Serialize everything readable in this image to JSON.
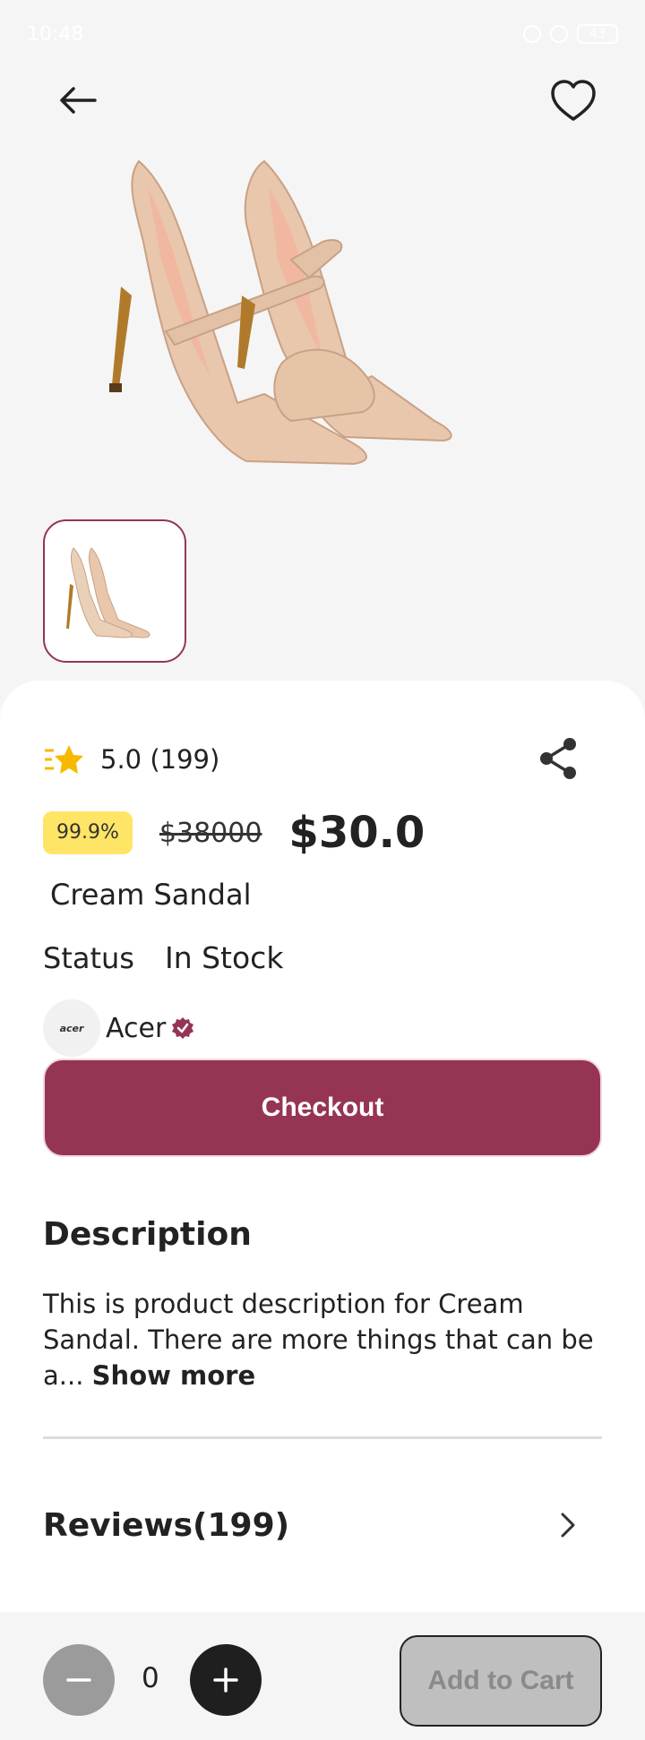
{
  "status_bar": {
    "time": "10:48",
    "battery": "43"
  },
  "product": {
    "rating": "5.0 (199)",
    "discount": "99.9%",
    "old_price": "$38000",
    "price": "$30.0",
    "name": "Cream Sandal",
    "status_label": "Status",
    "status_value": "In Stock"
  },
  "brand": {
    "logo_text": "acer",
    "name": "Acer"
  },
  "actions": {
    "checkout_label": "Checkout",
    "add_to_cart_label": "Add to Cart"
  },
  "description": {
    "heading": "Description",
    "text": "This is product description for Cream Sandal. There are more things that can be a...",
    "show_more": "Show more"
  },
  "reviews": {
    "title": "Reviews(199)"
  },
  "quantity": {
    "value": "0"
  },
  "colors": {
    "accent": "#953553",
    "badge": "#ffe566",
    "star": "#f7b800"
  },
  "icons": [
    "back-arrow-icon",
    "heart-icon",
    "star-icon",
    "share-icon",
    "verified-badge-icon",
    "chevron-right-icon",
    "minus-icon",
    "plus-icon"
  ]
}
